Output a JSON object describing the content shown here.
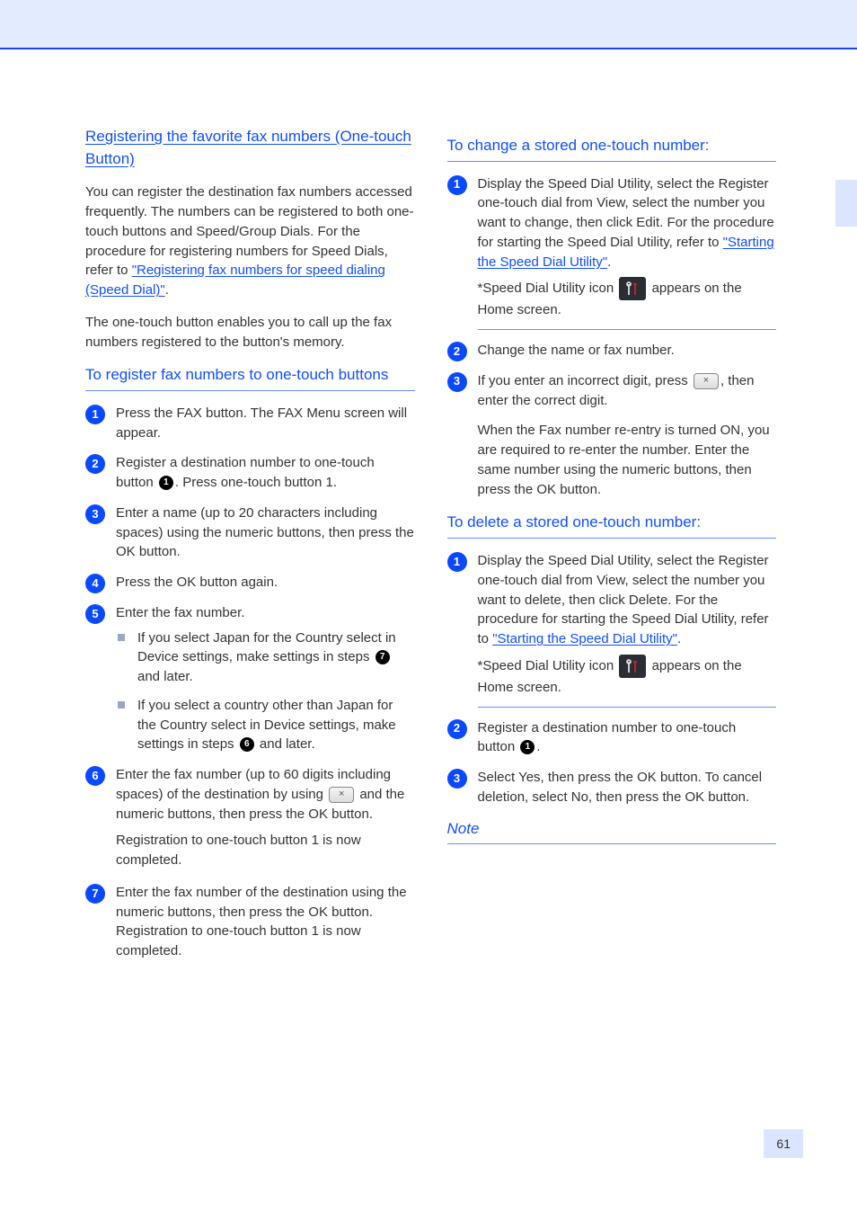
{
  "left": {
    "sec1_head": "Registering the favorite fax numbers (One-touch Button)",
    "sec1_p1_a": "You can register the destination fax numbers accessed frequently. The numbers can be registered to both one-touch buttons and Speed/Group Dials. For the procedure for registering numbers for Speed Dials, refer to ",
    "sec1_p1_link": "\"Registering fax numbers for speed dialing (Speed Dial)\"",
    "sec1_p1_b": ".",
    "sec1_p2": "The one-touch button enables you to call up the fax numbers registered to the button's memory.",
    "rule1_head": "To register fax numbers to one-touch buttons",
    "step1": "Press the FAX button. The FAX Menu screen will appear.",
    "step2_a": "Register a destination number to one-touch button ",
    "step2_ref": "1",
    "step2_b": ". Press one-touch button 1.",
    "step3": "Enter a name (up to 20 characters including spaces) using the numeric buttons, then press the OK button.",
    "step4": "Press the OK button again.",
    "step5_head": "Enter the fax number.",
    "step5_b1_a": "If you select Japan for the Country select in Device settings, make settings in steps ",
    "step5_b1_ref": "7",
    "step5_b1_b": " and later.",
    "step5_b2_a": "If you select a country other than Japan for the Country select in Device settings, make settings in steps ",
    "step5_b2_ref": "6",
    "step5_b2_b": " and later.",
    "step6_a": "Enter the fax number (up to 60 digits including spaces) of the destination by using ",
    "step6_b": " and the numeric buttons, then press the OK button.",
    "step6_p2": "Registration to one-touch button 1 is now completed.",
    "step7": "Enter the fax number of the destination using the numeric buttons, then press the OK button. Registration to one-touch button 1 is now completed."
  },
  "right": {
    "chg_head": "To change a stored one-touch number:",
    "chg_s1_a": "Display the Speed Dial Utility, select the Register one-touch dial from View, select the number you want to change, then click Edit. For the procedure for starting the Speed Dial Utility, refer to ",
    "chg_s1_link": "\"Starting the Speed Dial Utility\"",
    "chg_s1_b": ".",
    "chg_note_a": "*Speed Dial Utility icon ",
    "chg_note_b": " appears on the Home screen.",
    "chg_s2": "Change the name or fax number.",
    "chg_s3_a": "If you enter an incorrect digit, press ",
    "chg_s3_b": ", then enter the correct digit.",
    "chg_note2": "When the Fax number re-entry is turned ON, you are required to re-enter the number. Enter the same number using the numeric buttons, then press the OK button.",
    "del_head": "To delete a stored one-touch number:",
    "del_s1_a": "Display the Speed Dial Utility, select the Register one-touch dial from View, select the number you want to delete, then click Delete. For the procedure for starting the Speed Dial Utility, refer to ",
    "del_s1_link": "\"Starting the Speed Dial Utility\"",
    "del_s1_b": ".",
    "del_note_a": "*Speed Dial Utility icon ",
    "del_note_b": " appears on the Home screen.",
    "del_s2_a": "Register a destination number to one-touch button ",
    "del_s2_ref": "1",
    "del_s2_b": ".",
    "del_s3": "Select Yes, then press the OK button. To cancel deletion, select No, then press the OK button.",
    "note_head": "Note"
  },
  "page": "61"
}
